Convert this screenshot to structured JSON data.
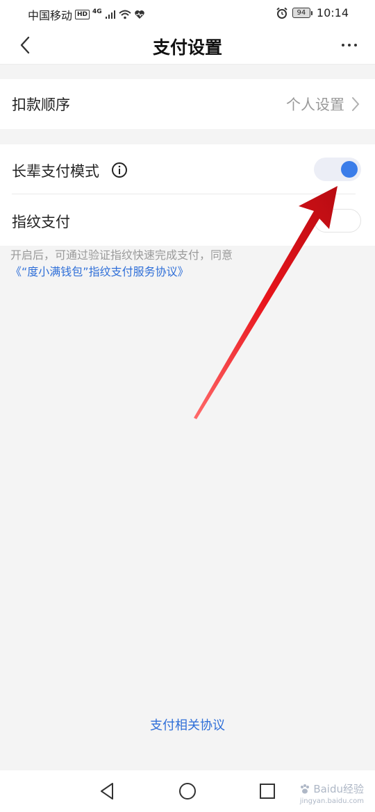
{
  "status_bar": {
    "carrier": "中国移动",
    "hd": "HD",
    "network": "4G",
    "battery": "94",
    "time": "10:14"
  },
  "navbar": {
    "title": "支付设置",
    "back_icon": "chevron-left-icon",
    "more_icon": "more-horizontal-icon"
  },
  "deduction_row": {
    "label": "扣款顺序",
    "value": "个人设置"
  },
  "elder_mode_row": {
    "label": "长辈支付模式",
    "toggle_on": true
  },
  "fingerprint_row": {
    "label": "指纹支付",
    "toggle_on": false
  },
  "fingerprint_desc": {
    "text": "开启后，可通过验证指纹快速完成支付，同意",
    "link": "《“度小满钱包”指纹支付服务协议》"
  },
  "footer": {
    "link": "支付相关协议"
  },
  "watermark": {
    "text": "Baidu经验",
    "sub": "jingyan.baidu.com"
  },
  "colors": {
    "accent": "#3b7de9",
    "link": "#2f6fd8",
    "annotation_arrow": "#e8141b",
    "background": "#f4f4f4"
  }
}
